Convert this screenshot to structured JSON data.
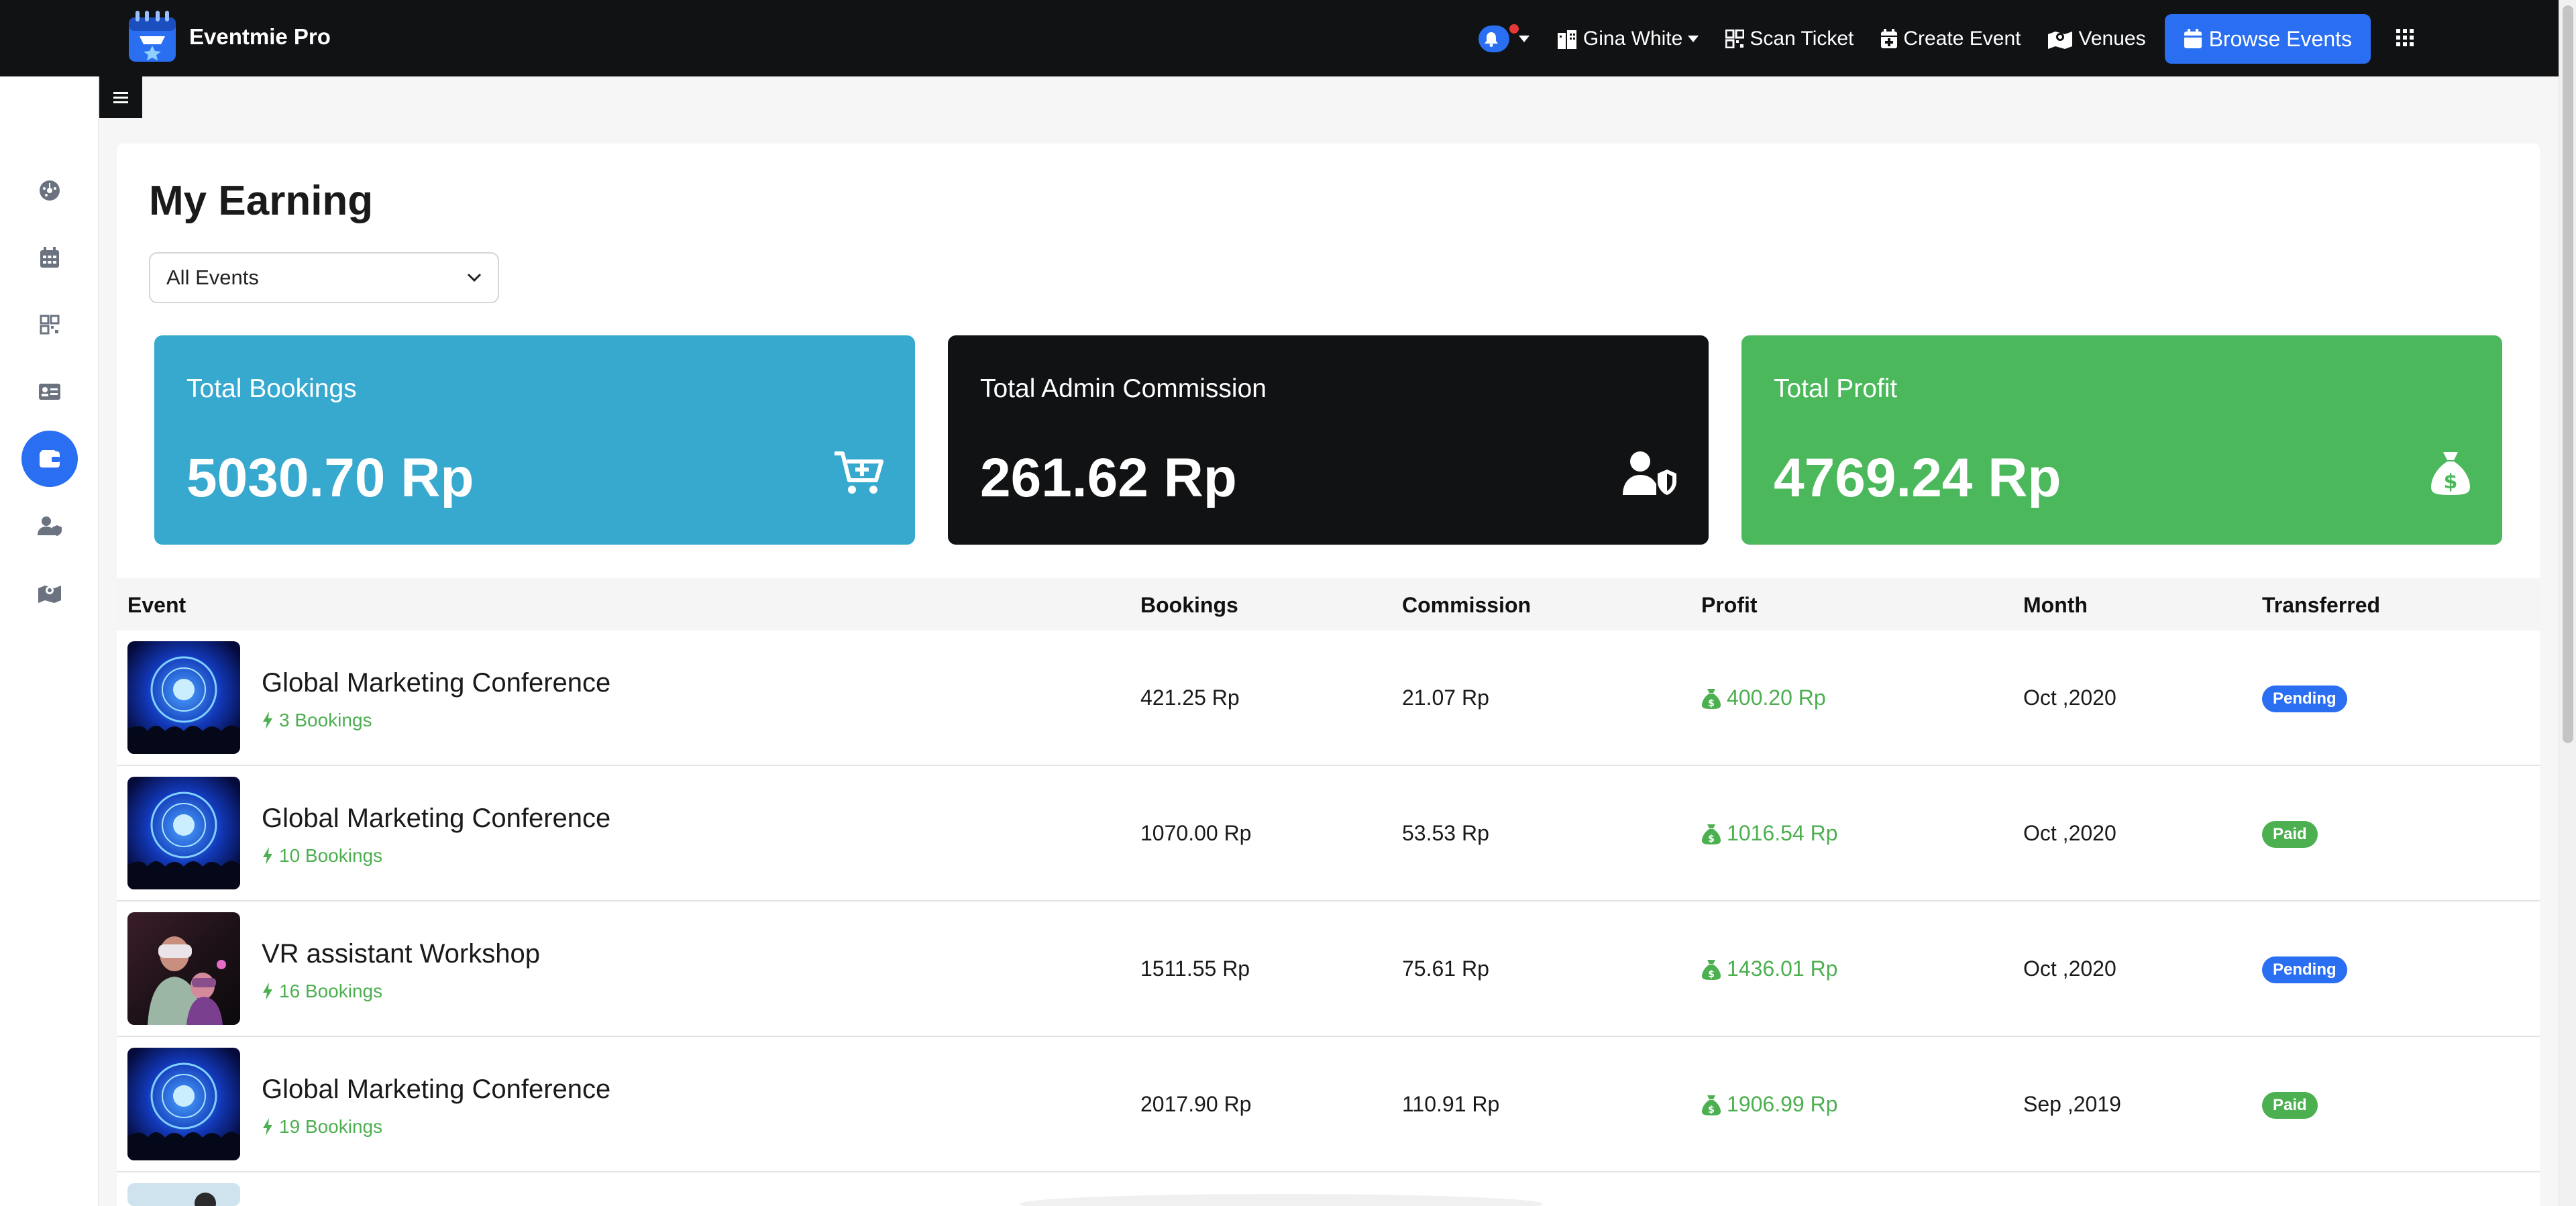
{
  "app": {
    "brand_name": "Eventmie Pro"
  },
  "navbar": {
    "user_name": "Gina White",
    "scan_ticket": "Scan Ticket",
    "create_event": "Create Event",
    "venues": "Venues",
    "browse_events": "Browse Events"
  },
  "sidebar": {
    "items": [
      "dashboard-icon",
      "calendar-icon",
      "qrcode-icon",
      "ticket-icon",
      "wallet-icon",
      "users-icon",
      "map-icon"
    ],
    "active_index": 4
  },
  "page": {
    "title": "My Earning",
    "filter_value": "All Events"
  },
  "cards": [
    {
      "label": "Total Bookings",
      "value": "5030.70 Rp",
      "color": "#37a9cf",
      "icon": "cart-plus-icon"
    },
    {
      "label": "Total Admin Commission",
      "value": "261.62 Rp",
      "color": "#111214",
      "icon": "user-shield-icon"
    },
    {
      "label": "Total Profit",
      "value": "4769.24 Rp",
      "color": "#4cb85c",
      "icon": "money-bag-icon"
    }
  ],
  "table": {
    "headers": {
      "event": "Event",
      "bookings": "Bookings",
      "commission": "Commission",
      "profit": "Profit",
      "month": "Month",
      "transferred": "Transferred"
    },
    "rows": [
      {
        "name": "Global Marketing Conference",
        "bookings_count": "3 Bookings",
        "bookings": "421.25 Rp",
        "commission": "21.07 Rp",
        "profit": "400.20 Rp",
        "month": "Oct ,2020",
        "status": "Pending"
      },
      {
        "name": "Global Marketing Conference",
        "bookings_count": "10 Bookings",
        "bookings": "1070.00 Rp",
        "commission": "53.53 Rp",
        "profit": "1016.54 Rp",
        "month": "Oct ,2020",
        "status": "Paid"
      },
      {
        "name": "VR assistant Workshop",
        "bookings_count": "16 Bookings",
        "bookings": "1511.55 Rp",
        "commission": "75.61 Rp",
        "profit": "1436.01 Rp",
        "month": "Oct ,2020",
        "status": "Pending"
      },
      {
        "name": "Global Marketing Conference",
        "bookings_count": "19 Bookings",
        "bookings": "2017.90 Rp",
        "commission": "110.91 Rp",
        "profit": "1906.99 Rp",
        "month": "Sep ,2019",
        "status": "Paid"
      }
    ]
  },
  "colors": {
    "accent": "#2a6ef2",
    "success": "#4caf50",
    "navbar": "#111214"
  }
}
